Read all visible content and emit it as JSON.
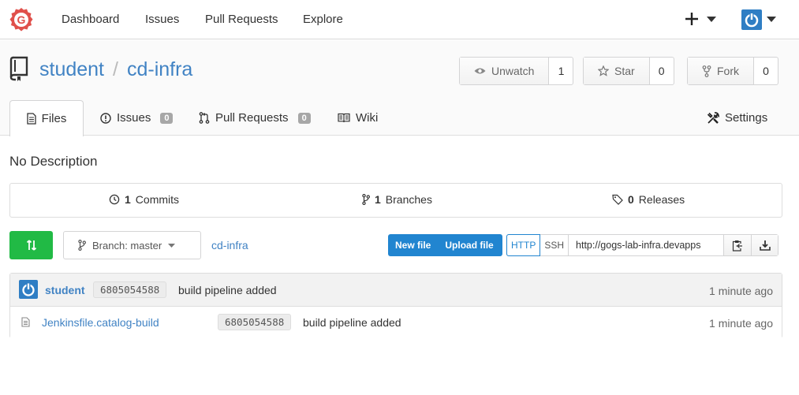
{
  "nav": {
    "links": [
      "Dashboard",
      "Issues",
      "Pull Requests",
      "Explore"
    ],
    "plus_icon": "plus-icon",
    "avatar_icon": "avatar-icon"
  },
  "repo": {
    "owner": "student",
    "separator": "/",
    "name": "cd-infra",
    "watch_label": "Unwatch",
    "watch_count": "1",
    "star_label": "Star",
    "star_count": "0",
    "fork_label": "Fork",
    "fork_count": "0"
  },
  "tabs": {
    "files": "Files",
    "issues": "Issues",
    "issues_count": "0",
    "pulls": "Pull Requests",
    "pulls_count": "0",
    "wiki": "Wiki",
    "settings": "Settings"
  },
  "description": "No Description",
  "stats": {
    "commits_num": "1",
    "commits_label": "Commits",
    "branches_num": "1",
    "branches_label": "Branches",
    "releases_num": "0",
    "releases_label": "Releases"
  },
  "toolbar": {
    "branch_label": "Branch: master",
    "breadcrumb": "cd-infra",
    "new_file": "New file",
    "upload_file": "Upload file",
    "http": "HTTP",
    "ssh": "SSH",
    "clone_url": "http://gogs-lab-infra.devapps"
  },
  "latest_commit": {
    "author": "student",
    "sha": "6805054588",
    "message": "build pipeline added",
    "time": "1 minute ago"
  },
  "files": [
    {
      "name": "Jenkinsfile.catalog-build",
      "sha": "6805054588",
      "message": "build pipeline added",
      "time": "1 minute ago"
    }
  ],
  "colors": {
    "link": "#4183c4",
    "primary": "#2185d0",
    "green": "#21ba45",
    "logo": "#e0504b"
  }
}
